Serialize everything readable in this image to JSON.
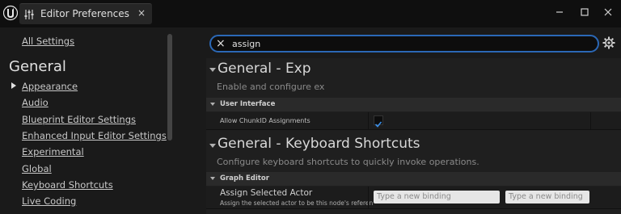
{
  "window": {
    "tab_title": "Editor Preferences",
    "tab_close": "×",
    "controls": [
      "minimize-icon",
      "maximize-icon",
      "close-icon"
    ]
  },
  "sidebar": {
    "all_settings": "All Settings",
    "heading": "General",
    "items": [
      {
        "label": "Appearance",
        "expanded_marker": true
      },
      {
        "label": "Audio"
      },
      {
        "label": "Blueprint Editor Settings"
      },
      {
        "label": "Enhanced Input Editor Settings"
      },
      {
        "label": "Experimental"
      },
      {
        "label": "Global"
      },
      {
        "label": "Keyboard Shortcuts"
      },
      {
        "label": "Live Coding"
      }
    ]
  },
  "search": {
    "value": "assign",
    "clear_icon": "×"
  },
  "sections": [
    {
      "title": "General - Exp",
      "description": "Enable and configure ex",
      "category": "User Interface",
      "properties": [
        {
          "name": "Allow ChunkID Assignments",
          "checked": true
        }
      ]
    },
    {
      "title": "General - Keyboard Shortcuts",
      "description": "Configure keyboard shortcuts to quickly invoke operations.",
      "category": "Graph Editor",
      "properties": [
        {
          "name": "Assign Selected Actor",
          "tooltip": "Assign the selected actor to be this node's referen",
          "binding_placeholder_1": "Type a new binding",
          "binding_placeholder_2": "Type a new binding"
        }
      ]
    }
  ],
  "colors": {
    "accent": "#2b68b6",
    "background": "#1a1a1a",
    "titlebar": "#0f0f0f"
  }
}
